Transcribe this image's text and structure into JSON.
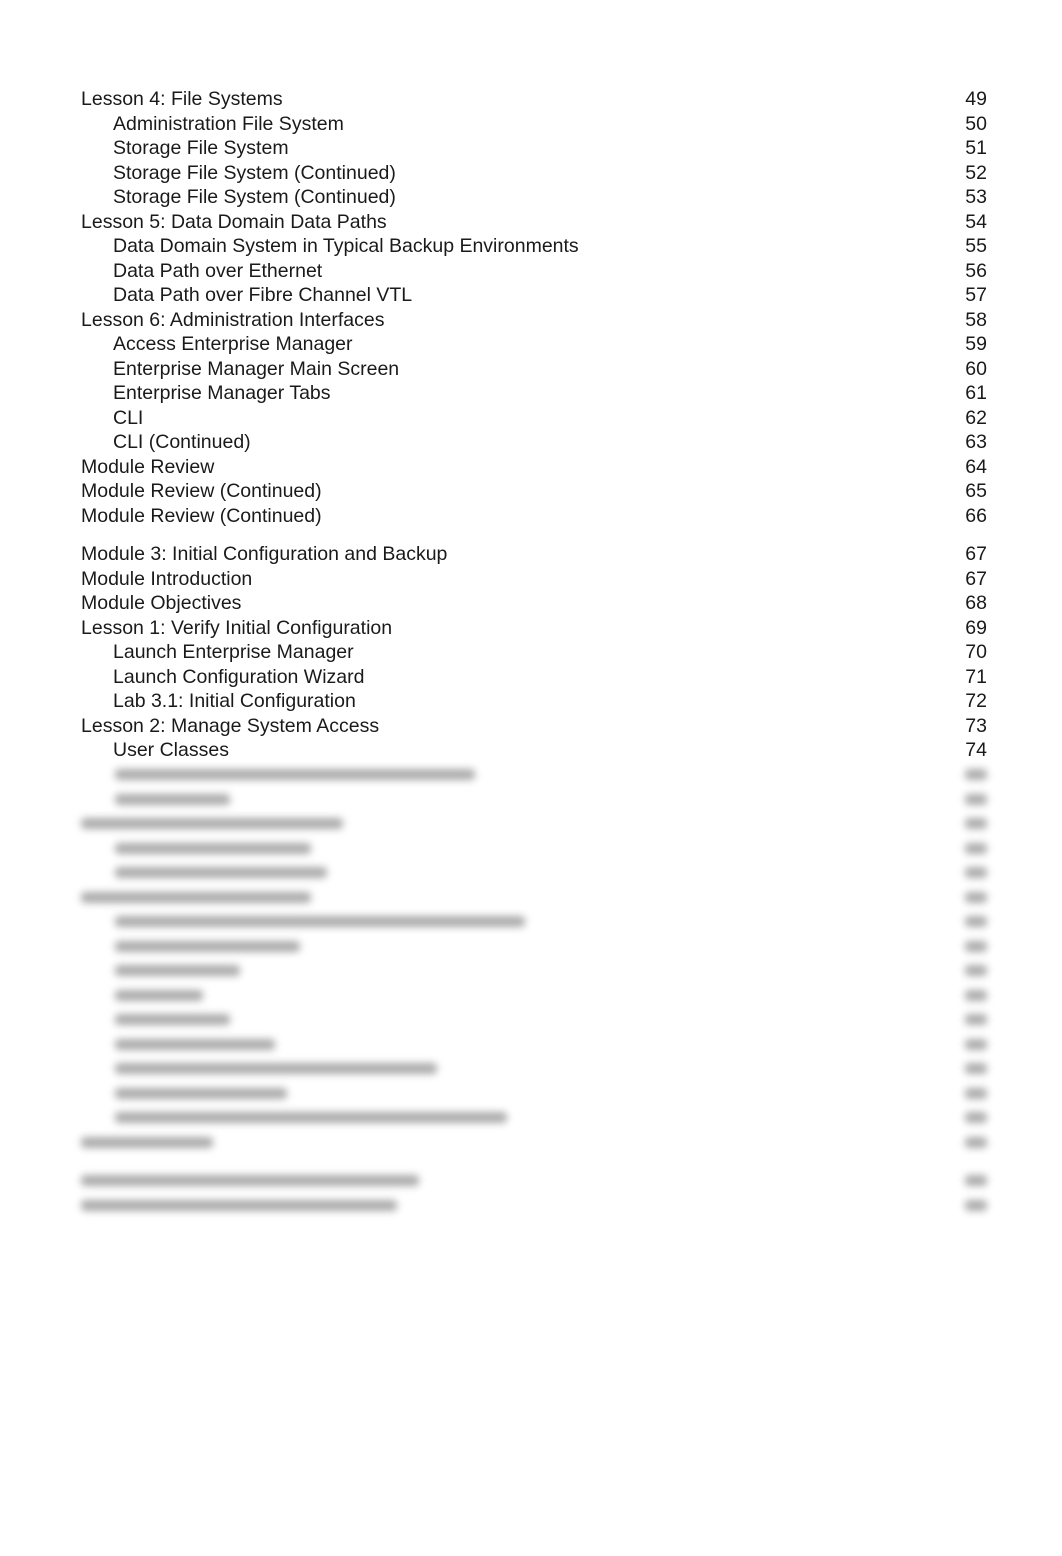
{
  "toc": {
    "section_a": [
      {
        "title": "Lesson 4: File Systems",
        "page": "49",
        "level": 0
      },
      {
        "title": "Administration File System",
        "page": "50",
        "level": 1
      },
      {
        "title": "Storage File System",
        "page": "51",
        "level": 1
      },
      {
        "title": "Storage File System (Continued)",
        "page": "52",
        "level": 1
      },
      {
        "title": "Storage File System (Continued)",
        "page": "53",
        "level": 1
      },
      {
        "title": "Lesson 5: Data Domain Data Paths",
        "page": "54",
        "level": 0
      },
      {
        "title": "Data Domain System in Typical Backup Environments",
        "page": "55",
        "level": 1
      },
      {
        "title": "Data Path over Ethernet",
        "page": "56",
        "level": 1
      },
      {
        "title": "Data Path over Fibre Channel VTL",
        "page": "57",
        "level": 1
      },
      {
        "title": "Lesson 6: Administration Interfaces",
        "page": "58",
        "level": 0
      },
      {
        "title": "Access Enterprise Manager",
        "page": "59",
        "level": 1
      },
      {
        "title": "Enterprise Manager Main Screen",
        "page": "60",
        "level": 1
      },
      {
        "title": "Enterprise Manager Tabs",
        "page": "61",
        "level": 1
      },
      {
        "title": "CLI",
        "page": "62",
        "level": 1
      },
      {
        "title": "CLI (Continued)",
        "page": "63",
        "level": 1
      },
      {
        "title": "Module Review",
        "page": "64",
        "level": 0
      },
      {
        "title": "Module Review (Continued)",
        "page": "65",
        "level": 0
      },
      {
        "title": "Module Review (Continued)",
        "page": "66",
        "level": 0
      }
    ],
    "section_b": [
      {
        "title": "Module 3: Initial Configuration and Backup",
        "page": "67",
        "level": 0
      },
      {
        "title": "Module Introduction",
        "page": "67",
        "level": 0
      },
      {
        "title": "Module Objectives",
        "page": "68",
        "level": 0
      },
      {
        "title": "Lesson 1: Verify Initial Configuration",
        "page": "69",
        "level": 0
      },
      {
        "title": "Launch Enterprise Manager",
        "page": "70",
        "level": 1
      },
      {
        "title": "Launch Configuration Wizard",
        "page": "71",
        "level": 1
      },
      {
        "title": "Lab 3.1: Initial Configuration",
        "page": "72",
        "level": 1
      },
      {
        "title": "Lesson 2: Manage System Access",
        "page": "73",
        "level": 0
      },
      {
        "title": "User Classes",
        "page": "74",
        "level": 1
      }
    ]
  }
}
